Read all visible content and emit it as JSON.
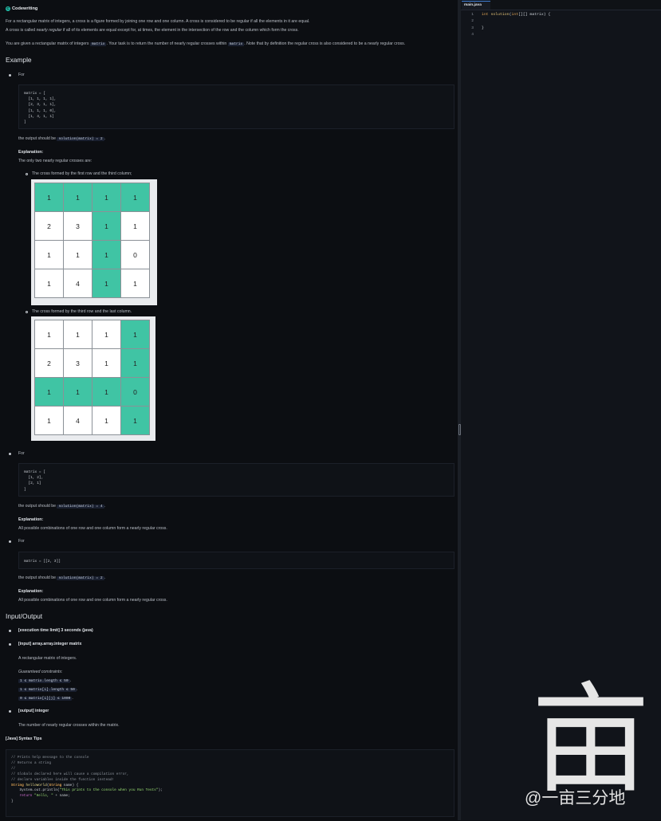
{
  "header": {
    "logo_glyph": "C",
    "title": "Codewriting"
  },
  "description": {
    "line1": "For a rectangular matrix of integers, a cross is a figure formed by joining one row and one column. A cross is considered to be regular if all the elements in it are equal.",
    "line2_a": "A cross is called ",
    "line2_em": "nearly regular",
    "line2_b": " if all of its elements are equal except for, at times, the element in the intersection of the row and the column which form the cross.",
    "line3_a": "You are given a rectangular matrix of integers ",
    "line3_code1": "matrix",
    "line3_b": ". Your task is to return the number of nearly regular crosses within ",
    "line3_code2": "matrix",
    "line3_c": ". Note that by definition the regular cross is also considered to be a nearly regular cross."
  },
  "example": {
    "heading": "Example",
    "for_label": "For",
    "ex1": {
      "code": "matrix = [\n  [1, 1, 1, 1],\n  [2, 3, 1, 1],\n  [1, 1, 1, 0],\n  [1, 4, 1, 1]\n]",
      "output_a": "the output should be ",
      "output_code": "solution(matrix) = 2",
      "output_b": ".",
      "explanation_label": "Explanation:",
      "explanation": "The only two nearly regular crosses are:",
      "cross1_caption": "The cross formed by the first row and the third column;",
      "cross2_caption": "The cross formed by the third row and the last column.",
      "grid1": [
        [
          {
            "v": "1",
            "h": true
          },
          {
            "v": "1",
            "h": true
          },
          {
            "v": "1",
            "h": true
          },
          {
            "v": "1",
            "h": true
          }
        ],
        [
          {
            "v": "2",
            "h": false
          },
          {
            "v": "3",
            "h": false
          },
          {
            "v": "1",
            "h": true
          },
          {
            "v": "1",
            "h": false
          }
        ],
        [
          {
            "v": "1",
            "h": false
          },
          {
            "v": "1",
            "h": false
          },
          {
            "v": "1",
            "h": true
          },
          {
            "v": "0",
            "h": false
          }
        ],
        [
          {
            "v": "1",
            "h": false
          },
          {
            "v": "4",
            "h": false
          },
          {
            "v": "1",
            "h": true
          },
          {
            "v": "1",
            "h": false
          }
        ]
      ],
      "grid2": [
        [
          {
            "v": "1",
            "h": false
          },
          {
            "v": "1",
            "h": false
          },
          {
            "v": "1",
            "h": false
          },
          {
            "v": "1",
            "h": true
          }
        ],
        [
          {
            "v": "2",
            "h": false
          },
          {
            "v": "3",
            "h": false
          },
          {
            "v": "1",
            "h": false
          },
          {
            "v": "1",
            "h": true
          }
        ],
        [
          {
            "v": "1",
            "h": true
          },
          {
            "v": "1",
            "h": true
          },
          {
            "v": "1",
            "h": true
          },
          {
            "v": "0",
            "h": true
          }
        ],
        [
          {
            "v": "1",
            "h": false
          },
          {
            "v": "4",
            "h": false
          },
          {
            "v": "1",
            "h": false
          },
          {
            "v": "1",
            "h": true
          }
        ]
      ]
    },
    "ex2": {
      "code": "matrix = [\n  [1, 2],\n  [2, 1]\n]",
      "output_a": "the output should be ",
      "output_code": "solution(matrix) = 4",
      "output_b": ".",
      "explanation_label": "Explanation:",
      "explanation": "All possible combinations of one row and one column form a nearly regular cross."
    },
    "ex3": {
      "code": "matrix = [[2, 3]]",
      "output_a": "the output should be ",
      "output_code": "solution(matrix) = 2",
      "output_b": ".",
      "explanation_label": "Explanation:",
      "explanation": "All possible combinations of one row and one column form a nearly regular cross."
    }
  },
  "io": {
    "heading": "Input/Output",
    "time_limit": "[execution time limit] 3 seconds (java)",
    "input_label": "[input] array.array.integer matrix",
    "input_desc": "A rectangular matrix of integers.",
    "constraints_label": "Guaranteed constraints:",
    "constraints": [
      "1 ≤ matrix.length ≤ 50",
      "1 ≤ matrix[i].length ≤ 50",
      "0 ≤ matrix[i][j] ≤ 1000"
    ],
    "output_label": "[output] integer",
    "output_desc": "The number of nearly regular crosses within the matrix."
  },
  "syntax_tips": {
    "heading": "[Java] Syntax Tips",
    "c1": "// Prints help message to the console",
    "c2": "// Returns a string",
    "c3": "//",
    "c4": "// Globals declared here will cause a compilation error,",
    "c5": "// declare variables inside the function instead!",
    "sig_type": "String",
    "sig_name": "helloWorld",
    "sig_open": "(",
    "sig_ptype": "String",
    "sig_rest": " name) {",
    "print_a": "    System.out.println(",
    "print_str": "\"This prints to the console when you Run Tests\"",
    "print_b": ");",
    "ret_kw": "    return",
    "ret_str": " \"Hello, \"",
    "ret_b": " + name;",
    "close": "}"
  },
  "editor": {
    "tab_label": "main.java",
    "line_numbers": [
      "1",
      "2",
      "3",
      "4"
    ],
    "line1_type": "int",
    "line1_fn": " solution",
    "line1_open": "(",
    "line1_ptype": "int",
    "line1_rest": "[][] matrix) {",
    "line3": "}"
  },
  "watermark": {
    "glyph": "亩",
    "text": "@一亩三分地"
  },
  "colors": {
    "accent": "#1fb8a4",
    "highlight_cell": "#40c4a4",
    "tab_border": "#3f7fd6",
    "background": "#0c0e12"
  }
}
